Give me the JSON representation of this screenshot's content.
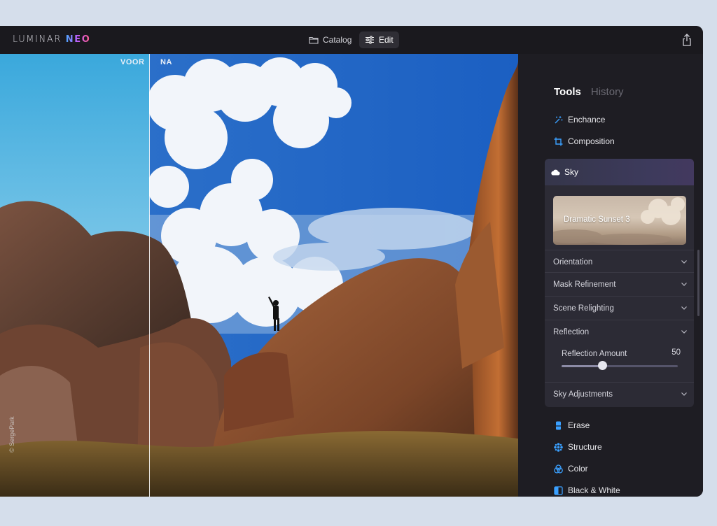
{
  "app": {
    "logo_main": "LUMINAR",
    "logo_accent": "NEO"
  },
  "topbar": {
    "catalog_label": "Catalog",
    "edit_label": "Edit"
  },
  "canvas": {
    "before_label": "VOOR",
    "after_label": "NA",
    "credit": "© SergePark"
  },
  "panel": {
    "tabs": [
      "Tools",
      "History"
    ],
    "tools_top": [
      {
        "label": "Enchance",
        "icon": "sparkle-icon"
      },
      {
        "label": "Composition",
        "icon": "crop-icon"
      }
    ],
    "sky": {
      "title": "Sky",
      "preset_name": "Dramatic Sunset 3",
      "sections": [
        "Orientation",
        "Mask Refinement",
        "Scene Relighting",
        "Reflection"
      ],
      "slider": {
        "label": "Reflection Amount",
        "value": 50,
        "fraction": 0.35
      },
      "last_section": "Sky Adjustments"
    },
    "tools_bottom": [
      {
        "label": "Erase",
        "icon": "eraser-icon"
      },
      {
        "label": "Structure",
        "icon": "structure-icon"
      },
      {
        "label": "Color",
        "icon": "color-icon"
      },
      {
        "label": "Black & White",
        "icon": "black-white-icon"
      }
    ]
  },
  "colors": {
    "accent": "#3aa0ff",
    "panel_bg": "#1e1d23",
    "card_bg": "#2c2b35"
  }
}
